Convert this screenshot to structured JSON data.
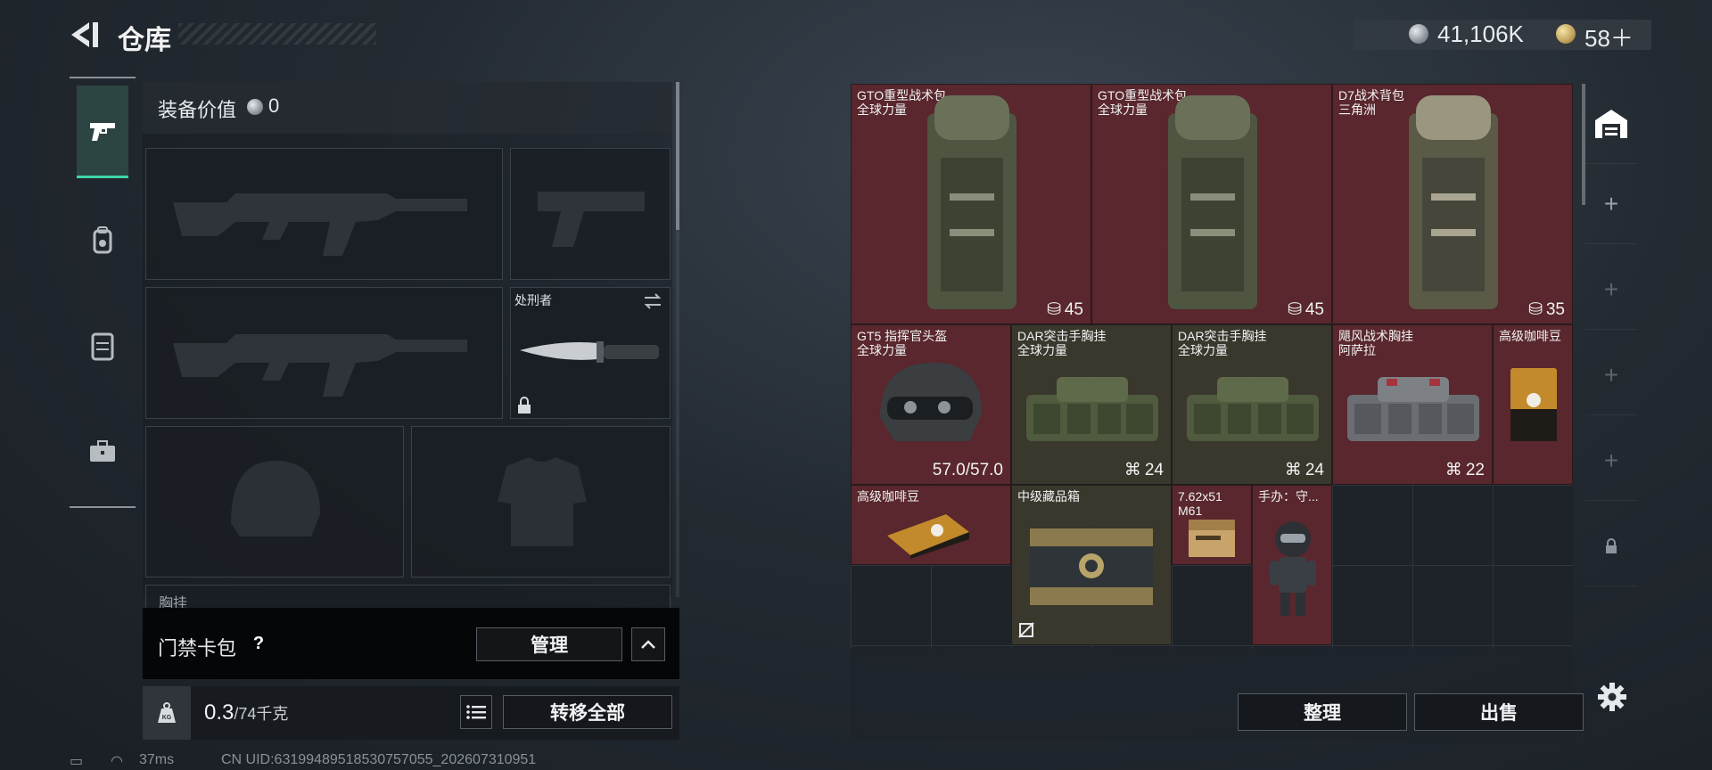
{
  "header": {
    "title": "仓库",
    "currency_silver": "41,106K",
    "currency_gold": "58＋"
  },
  "left_nav": {
    "items": [
      "weapon",
      "backpack",
      "vest",
      "case"
    ]
  },
  "equipment": {
    "value_label": "装备价值",
    "value": "0",
    "knife_slot_label": "处刑者",
    "chest_label_partial": "胸挂",
    "keycard_label": "门禁卡包",
    "manage_label": "管理",
    "weight_current": "0.3",
    "weight_max": "/74千克",
    "transfer_all_label": "转移全部",
    "kg_label": "KG"
  },
  "status": {
    "ping": "37ms",
    "uid": "CN UID:631994895185307570​55_202607310951"
  },
  "items": [
    {
      "id": "gto1",
      "name": "GTO重型战术包",
      "sub": "全球力量",
      "count": "45"
    },
    {
      "id": "gto2",
      "name": "GTO重型战术包",
      "sub": "全球力量",
      "count": "45"
    },
    {
      "id": "d7",
      "name": "D7战术背包",
      "sub": "三角洲",
      "count": "35"
    },
    {
      "id": "gt5",
      "name": "GT5 指挥官头盔",
      "sub": "全球力量",
      "count": "57.0/57.0"
    },
    {
      "id": "dar1",
      "name": "DAR突击手胸挂",
      "sub": "全球力量",
      "count": "24"
    },
    {
      "id": "dar2",
      "name": "DAR突击手胸挂",
      "sub": "全球力量",
      "count": "24"
    },
    {
      "id": "hurricane",
      "name": "飓风战术胸挂",
      "sub": "阿萨拉",
      "count": "22"
    },
    {
      "id": "coffee1",
      "name": "高级咖啡豆",
      "sub": "",
      "count": ""
    },
    {
      "id": "coffee2",
      "name": "高级咖啡豆",
      "sub": "",
      "count": ""
    },
    {
      "id": "box",
      "name": "中级藏品箱",
      "sub": "",
      "count": ""
    },
    {
      "id": "ammo",
      "name": "7.62x51 M61",
      "sub": "",
      "count": ""
    },
    {
      "id": "figure",
      "name": "手办：守...",
      "sub": "",
      "count": ""
    }
  ],
  "bottom_buttons": {
    "sort": "整理",
    "sell": "出售"
  },
  "colors": {
    "accent": "#3fd6a8",
    "item_red": "#60282e",
    "item_olive": "#3e3a2c",
    "item_gold": "#584226"
  }
}
